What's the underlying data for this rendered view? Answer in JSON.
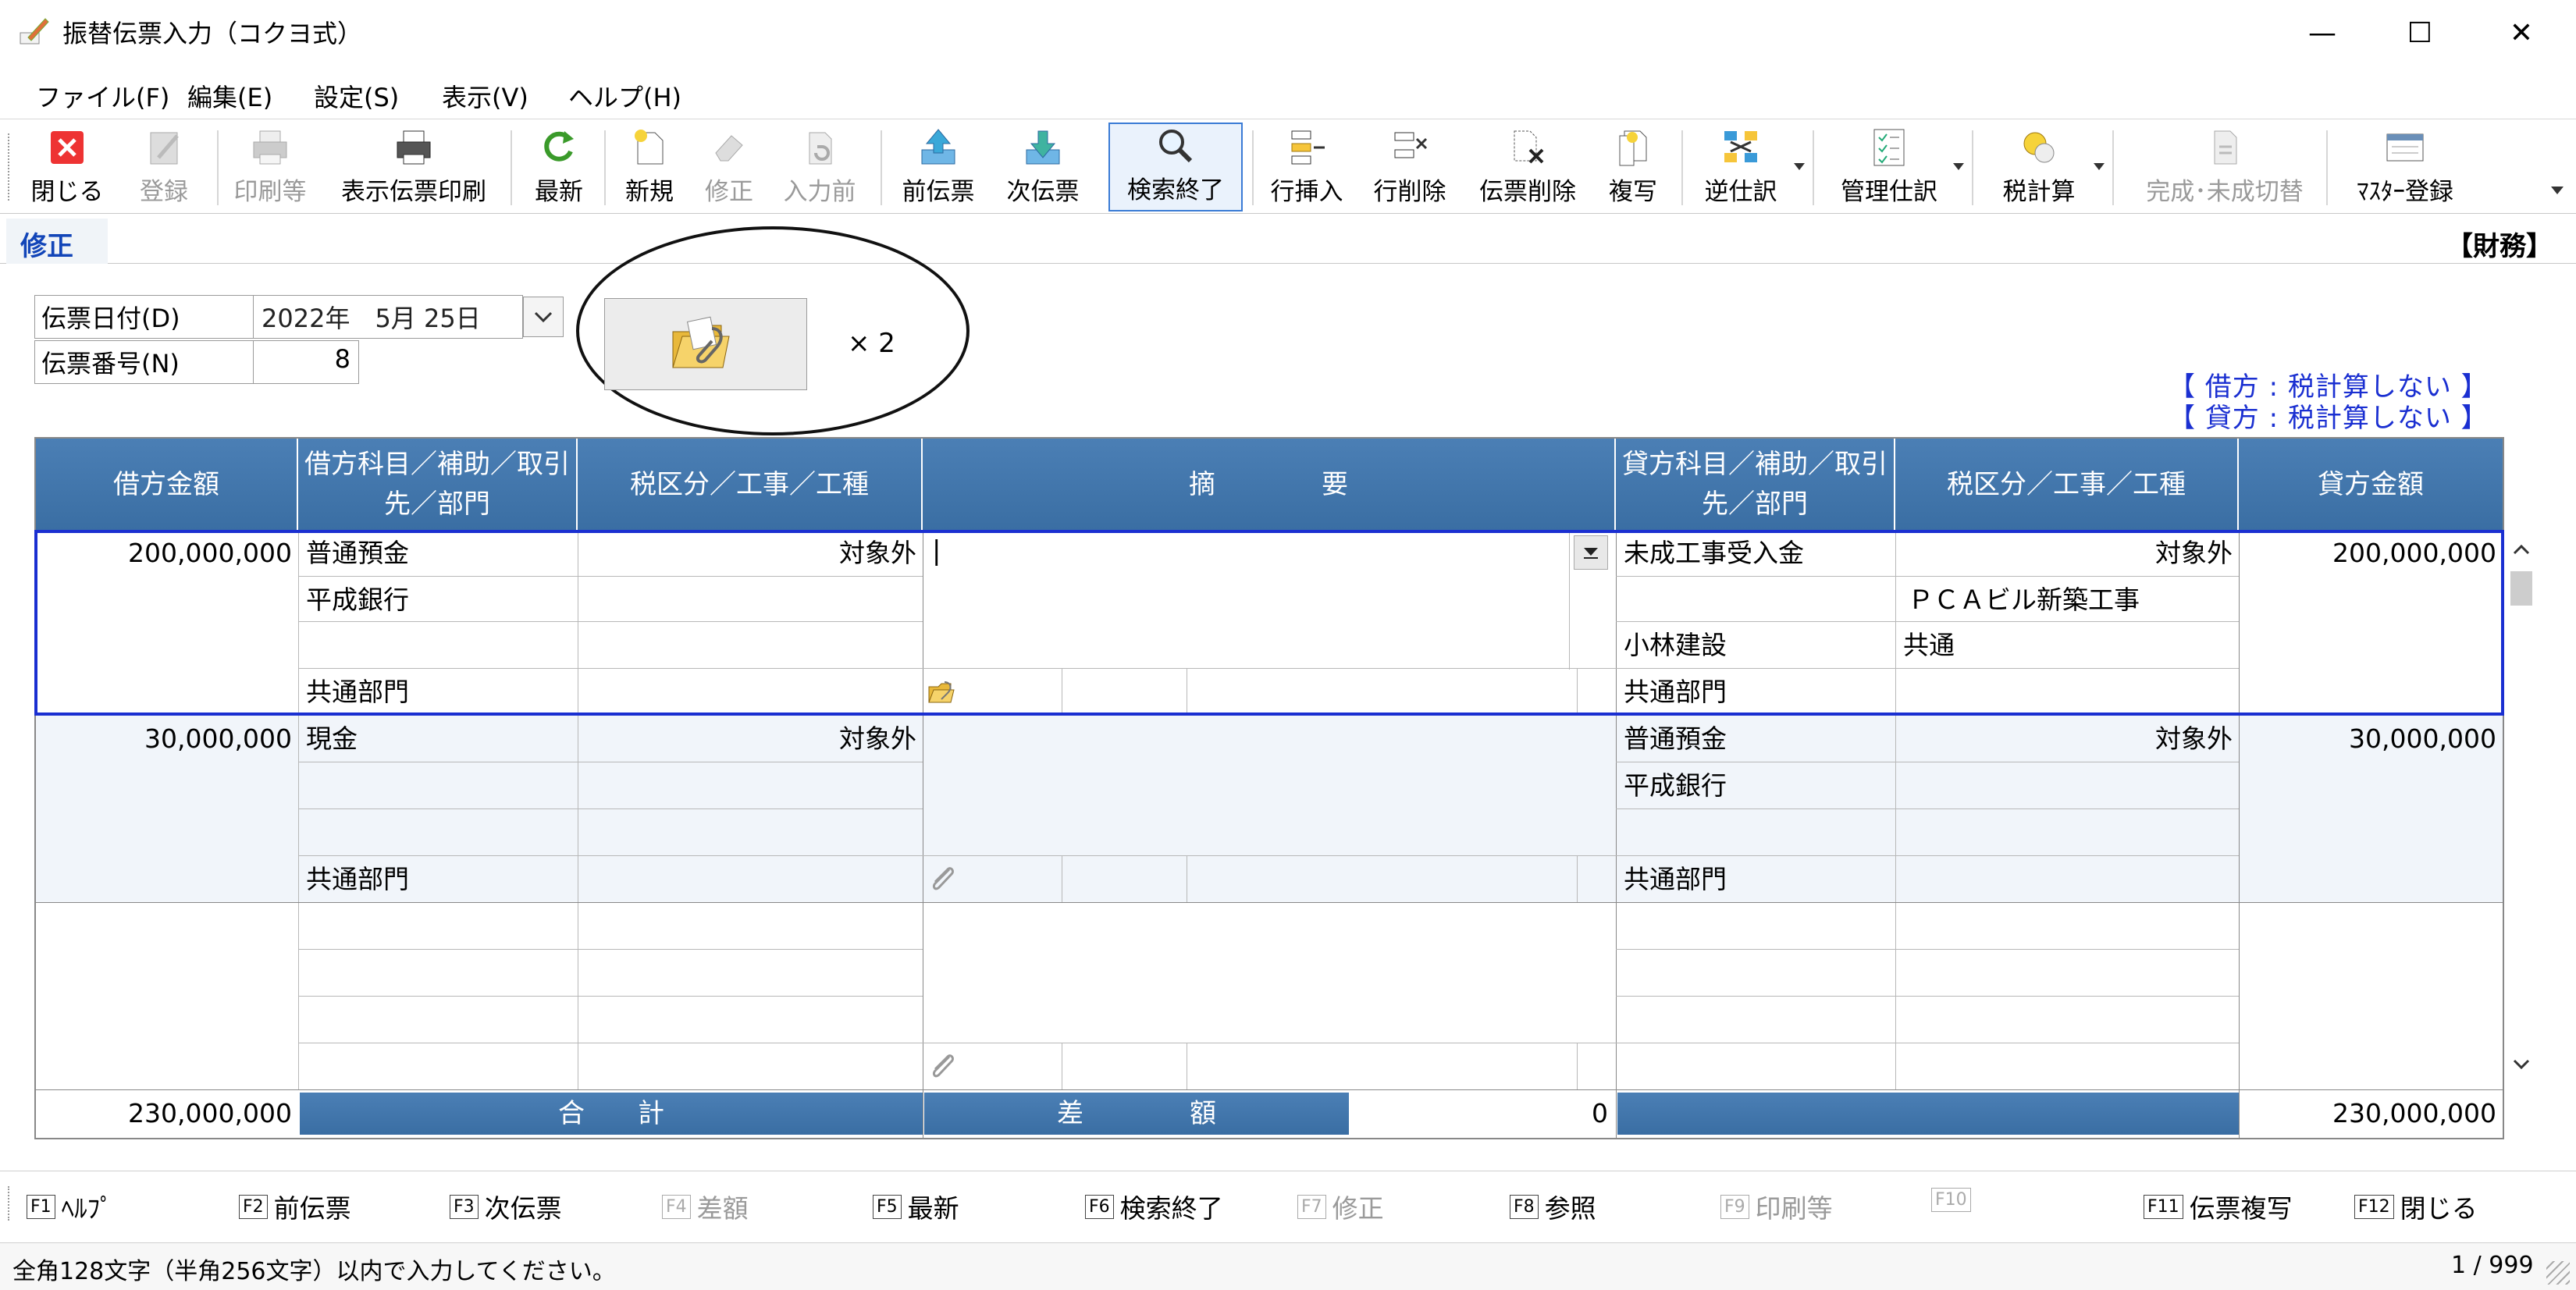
{
  "window": {
    "title": "振替伝票入力（コクヨ式）",
    "controls": {
      "minimize": "—",
      "maximize": "☐",
      "close": "✕"
    }
  },
  "menu": [
    "ファイル(F)",
    "編集(E)",
    "設定(S)",
    "表示(V)",
    "ヘルプ(H)"
  ],
  "toolbar": {
    "close": "閉じる",
    "register": "登録",
    "print_etc": "印刷等",
    "print_display": "表示伝票印刷",
    "refresh": "最新",
    "new": "新規",
    "modify": "修正",
    "before_input": "入力前",
    "prev_slip": "前伝票",
    "next_slip": "次伝票",
    "search_end": "検索終了",
    "insert_row": "行挿入",
    "delete_row": "行削除",
    "delete_slip": "伝票削除",
    "copy": "複写",
    "reverse_entry": "逆仕訳",
    "mgmt_entry": "管理仕訳",
    "tax_calc": "税計算",
    "complete_toggle": "完成･未成切替",
    "master_register": "ﾏｽﾀｰ登録"
  },
  "mode": "修正",
  "department": "【財務】",
  "header": {
    "date_label": "伝票日付(D)",
    "date_value": "2022年　5月 25日",
    "number_label": "伝票番号(N)",
    "number_value": "8",
    "attachment_count": "× 2",
    "debit_tax": "【 借方 : 税計算しない 】",
    "credit_tax": "【 貸方 : 税計算しない 】"
  },
  "columns": {
    "debit_amount": "借方金額",
    "debit_account": "借方科目／補助／取引先／部門",
    "debit_tax": "税区分／工事／工種",
    "summary": "摘　　　　要",
    "credit_account": "貸方科目／補助／取引先／部門",
    "credit_tax": "税区分／工事／工種",
    "credit_amount": "貸方金額"
  },
  "rows": [
    {
      "debit_amount": "200,000,000",
      "debit_account": "普通預金",
      "debit_tax": "対象外",
      "debit_sub": "平成銀行",
      "debit_partner": "",
      "debit_dept": "共通部門",
      "summary": "|",
      "credit_account": "未成工事受入金",
      "credit_tax": "対象外",
      "credit_sub": "",
      "credit_project": "ＰＣＡビル新築工事",
      "credit_partner": "小林建設",
      "credit_worktype": "共通",
      "credit_dept": "共通部門",
      "credit_amount": "200,000,000"
    },
    {
      "debit_amount": "30,000,000",
      "debit_account": "現金",
      "debit_tax": "対象外",
      "debit_sub": "",
      "debit_partner": "",
      "debit_dept": "共通部門",
      "summary": "",
      "credit_account": "普通預金",
      "credit_tax": "対象外",
      "credit_sub": "平成銀行",
      "credit_project": "",
      "credit_partner": "",
      "credit_worktype": "",
      "credit_dept": "共通部門",
      "credit_amount": "30,000,000"
    }
  ],
  "totals": {
    "debit_total": "230,000,000",
    "total_label": "合　　計",
    "diff_label": "差　　　　額",
    "diff_value": "0",
    "credit_total": "230,000,000"
  },
  "fkeys": [
    {
      "key": "F1",
      "label": "ﾍﾙﾌﾟ",
      "enabled": true
    },
    {
      "key": "F2",
      "label": "前伝票",
      "enabled": true
    },
    {
      "key": "F3",
      "label": "次伝票",
      "enabled": true
    },
    {
      "key": "F4",
      "label": "差額",
      "enabled": false
    },
    {
      "key": "F5",
      "label": "最新",
      "enabled": true
    },
    {
      "key": "F6",
      "label": "検索終了",
      "enabled": true
    },
    {
      "key": "F7",
      "label": "修正",
      "enabled": false
    },
    {
      "key": "F8",
      "label": "参照",
      "enabled": true
    },
    {
      "key": "F9",
      "label": "印刷等",
      "enabled": false
    },
    {
      "key": "F10",
      "label": "",
      "enabled": false
    },
    {
      "key": "F11",
      "label": "伝票複写",
      "enabled": true
    },
    {
      "key": "F12",
      "label": "閉じる",
      "enabled": true
    }
  ],
  "status": {
    "message": "全角128文字（半角256文字）以内で入力してください。",
    "page": "1 / 999"
  },
  "colors": {
    "header_blue": "#3f73a8",
    "selection_blue": "#1a2fd1",
    "mode_text": "#1245b8"
  }
}
